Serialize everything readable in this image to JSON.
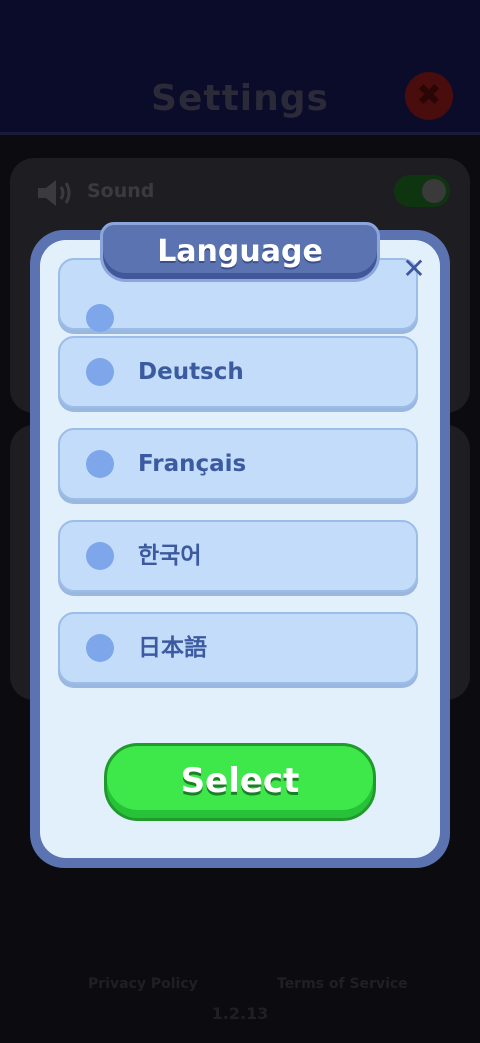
{
  "background": {
    "title": "Settings",
    "close_glyph": "✖",
    "sound_label": "Sound",
    "sound_icon": "speaker-icon",
    "privacy_link": "Privacy Policy",
    "terms_link": "Terms of Service",
    "version": "1.2.13"
  },
  "modal": {
    "title": "Language",
    "close_glyph": "✕",
    "languages": [
      {
        "label": ""
      },
      {
        "label": "Deutsch"
      },
      {
        "label": "Français"
      },
      {
        "label": "한국어"
      },
      {
        "label": "日本語"
      }
    ],
    "select_label": "Select"
  },
  "colors": {
    "modal_frame": "#5b73b0",
    "modal_body": "#e2f0fc",
    "item_bg": "#c2dcfa",
    "item_text": "#3c5aa0",
    "select_green": "#3ee84a"
  }
}
